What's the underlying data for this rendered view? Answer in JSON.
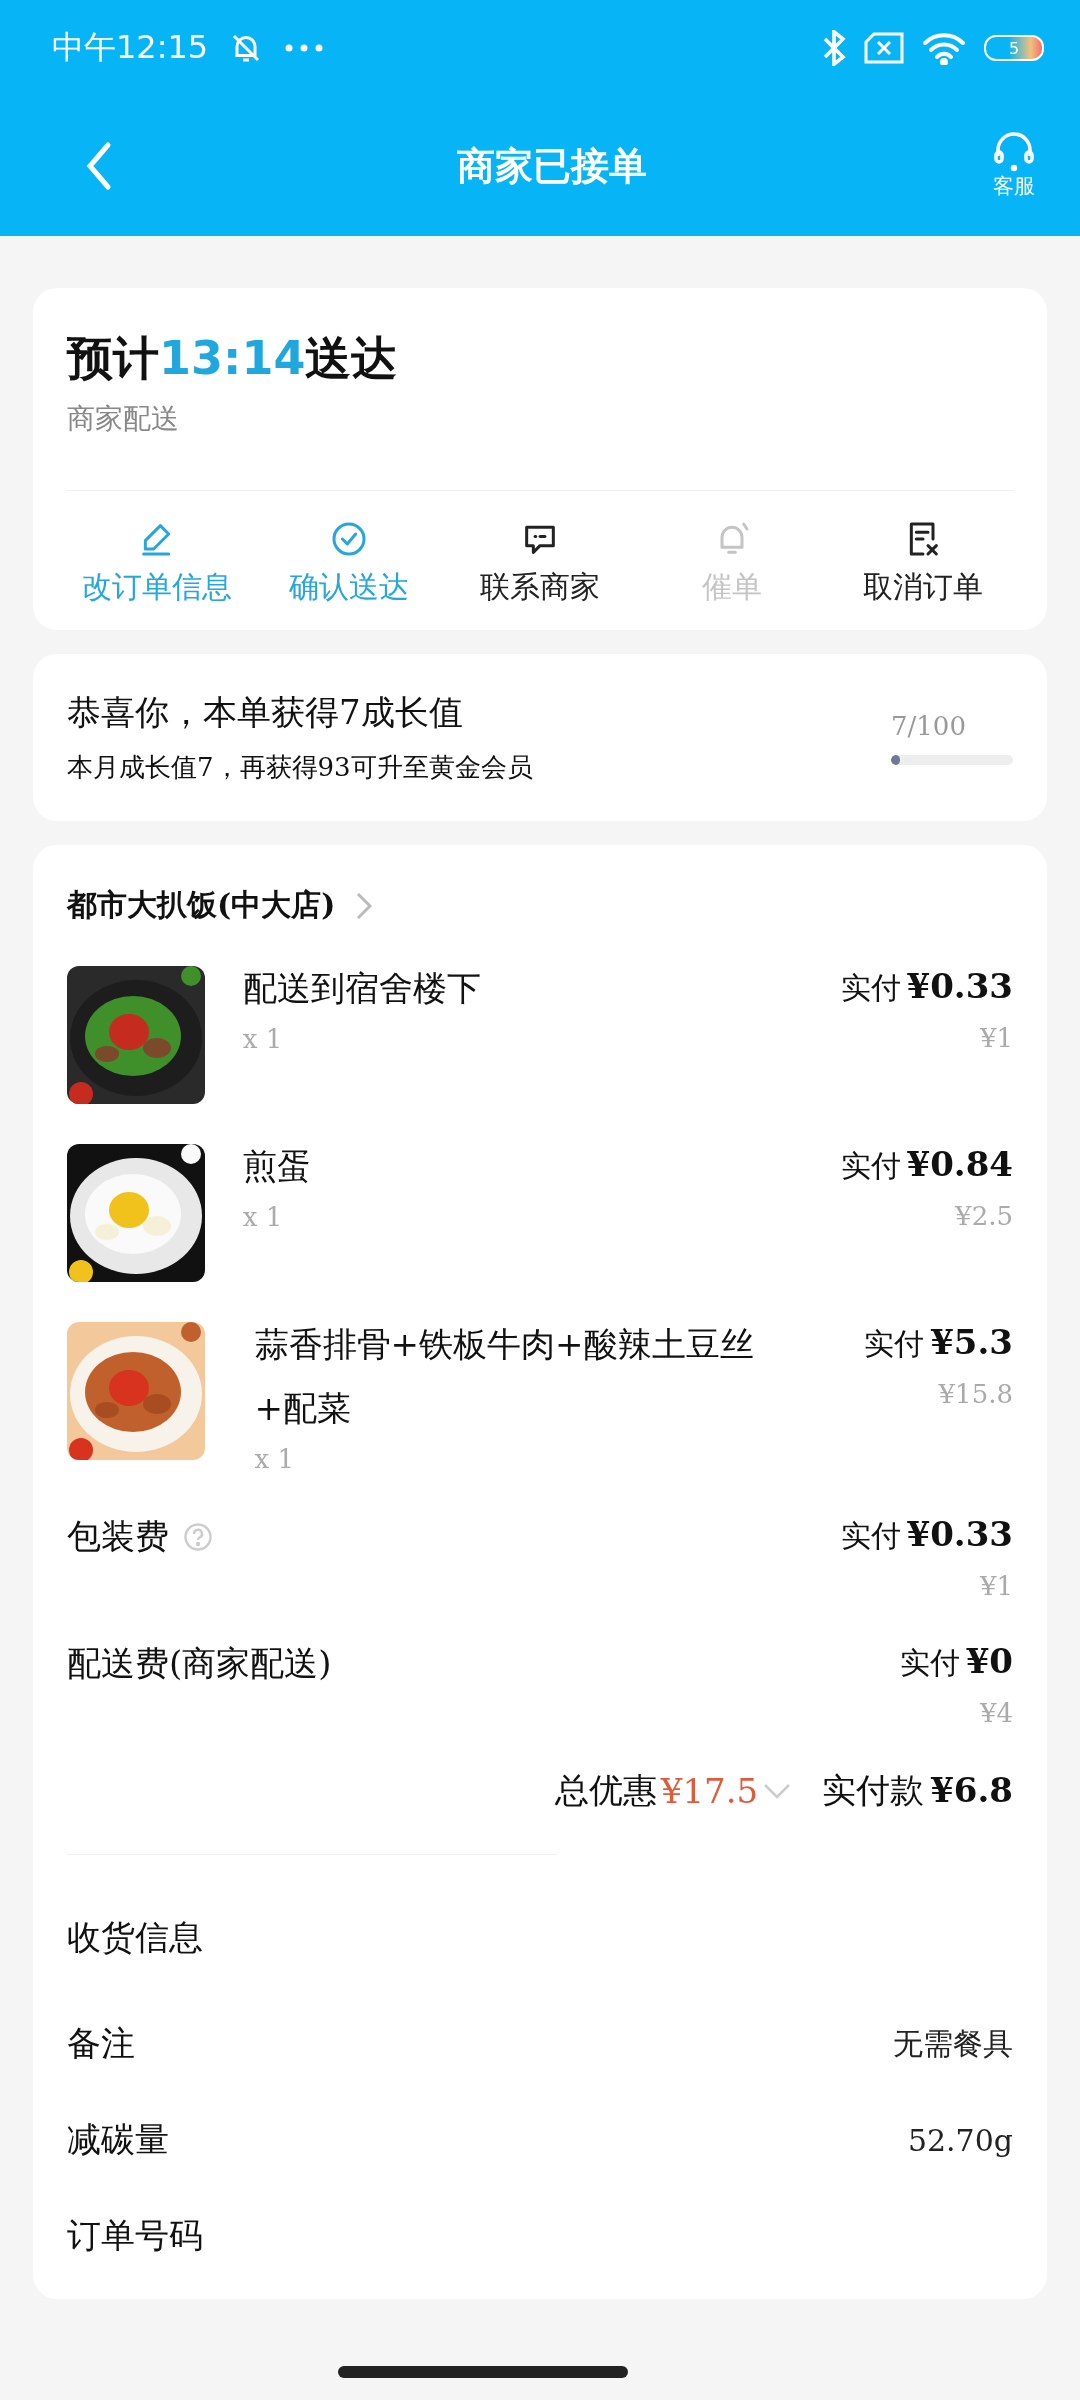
{
  "status_bar": {
    "time": "中午12:15",
    "battery": "5"
  },
  "header": {
    "title": "商家已接单",
    "service_label": "客服"
  },
  "delivery": {
    "prefix": "预计",
    "time": "13:14",
    "suffix": "送达",
    "mode": "商家配送",
    "actions": [
      {
        "kind": "edit",
        "label": "改订单信息",
        "highlighted": true,
        "disabled": false
      },
      {
        "kind": "confirm",
        "label": "确认送达",
        "highlighted": true,
        "disabled": false
      },
      {
        "kind": "chat",
        "label": "联系商家",
        "highlighted": false,
        "disabled": false
      },
      {
        "kind": "bell",
        "label": "催单",
        "highlighted": false,
        "disabled": true
      },
      {
        "kind": "cancel",
        "label": "取消订单",
        "highlighted": false,
        "disabled": false
      }
    ]
  },
  "growth": {
    "title": "恭喜你，本单获得7成长值",
    "detail": "本月成长值7，再获得93可升至黄金会员",
    "progress_text": "7/100",
    "level": 0.07
  },
  "store": {
    "name": "都市大扒饭(中大店)",
    "items": [
      {
        "name": "配送到宿舍楼下",
        "quantity": "x 1",
        "paid_label": "实付",
        "paid": "¥0.33",
        "original": "¥1",
        "kind": "picture"
      },
      {
        "name": "煎蛋",
        "quantity": "x 1",
        "paid_label": "实付",
        "paid": "¥0.84",
        "original": "¥2.5",
        "kind": "picture"
      },
      {
        "name": "蒜香排骨+铁板牛肉+酸辣土豆丝+配菜",
        "quantity": "x 1",
        "paid_label": "实付",
        "paid": "¥5.3",
        "original": "¥15.8",
        "kind": "picture"
      }
    ],
    "fees": [
      {
        "name": "包装费",
        "help": true,
        "paid_label": "实付",
        "paid": "¥0.33",
        "original": "¥1"
      },
      {
        "name": "配送费(商家配送)",
        "help": false,
        "paid_label": "实付",
        "paid": "¥0",
        "original": "¥4"
      }
    ],
    "discount_label": "总优惠",
    "discount": "¥17.5",
    "total_label": "实付款",
    "total": "¥6.8"
  },
  "info_rows": [
    {
      "label": "收货信息"
    },
    {
      "label": "备注",
      "value": "无需餐具"
    },
    {
      "label": "减碳量",
      "value": "52.70g"
    },
    {
      "label": "订单号码"
    }
  ]
}
